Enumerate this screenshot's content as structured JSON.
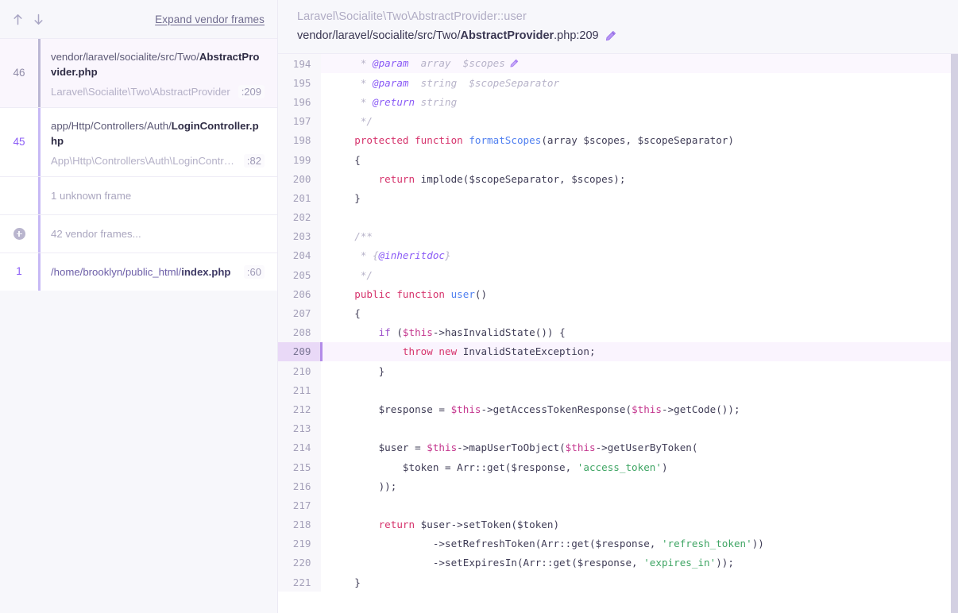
{
  "toolbar": {
    "nav_up_label": "↑",
    "nav_down_label": "↓",
    "expand_vendor_label": "Expand vendor frames"
  },
  "frames": [
    {
      "number": "46",
      "path_prefix": "vendor/laravel/socialite/src/Two/",
      "path_file": "AbstractProvider.php",
      "class_name": "Laravel\\Socialite\\Two\\AbstractProvider",
      "line_badge": ":209",
      "selected": true
    },
    {
      "number": "45",
      "path_prefix": "app/Http/Controllers/Auth/",
      "path_file": "LoginController.php",
      "class_name": "App\\Http\\Controllers\\Auth\\LoginController",
      "line_badge": ":82",
      "selected": false
    }
  ],
  "unknown_frame": {
    "label": "1 unknown frame"
  },
  "vendor_frames": {
    "label": "42 vendor frames...",
    "icon": "plus-circle-icon"
  },
  "entry_frame": {
    "number": "1",
    "path_prefix": "/home/brooklyn/public_html/",
    "path_file": "index.php",
    "line_badge": ":60"
  },
  "code_header": {
    "class_method": "Laravel\\Socialite\\Two\\AbstractProvider::user",
    "file_prefix": "vendor/laravel/socialite/src/Two/",
    "file_name": "AbstractProvider",
    "file_suffix": ".php:209",
    "edit_icon": "pencil-icon"
  },
  "code": {
    "highlighted_line": 209,
    "hover_line": 194,
    "lines": [
      {
        "n": "194",
        "html": "    <span class='t-cmt'>* </span><span class='t-tag'>@param</span><span class='t-cmt'>  array  $scopes</span>",
        "pencil": true
      },
      {
        "n": "195",
        "html": "    <span class='t-cmt'>* </span><span class='t-tag'>@param</span><span class='t-cmt'>  string  $scopeSeparator</span>"
      },
      {
        "n": "196",
        "html": "    <span class='t-cmt'>* </span><span class='t-tag'>@return</span><span class='t-cmt'> string</span>"
      },
      {
        "n": "197",
        "html": "    <span class='t-cmt'>*/</span>"
      },
      {
        "n": "198",
        "html": "   <span class='t-kw'>protected function </span><span class='t-fn'>formatScopes</span><span class='t-punct'>(array $scopes, $scopeSeparator)</span>"
      },
      {
        "n": "199",
        "html": "   <span class='t-punct'>{</span>"
      },
      {
        "n": "200",
        "html": "       <span class='t-kw'>return</span><span class='t-punct'> implode($scopeSeparator, $scopes);</span>"
      },
      {
        "n": "201",
        "html": "   <span class='t-punct'>}</span>"
      },
      {
        "n": "202",
        "html": ""
      },
      {
        "n": "203",
        "html": "   <span class='t-cmt'>/**</span>"
      },
      {
        "n": "204",
        "html": "    <span class='t-cmt'>* {</span><span class='t-tag'>@inheritdoc</span><span class='t-cmt'>}</span>"
      },
      {
        "n": "205",
        "html": "    <span class='t-cmt'>*/</span>"
      },
      {
        "n": "206",
        "html": "   <span class='t-kw'>public function </span><span class='t-fn'>user</span><span class='t-punct'>()</span>"
      },
      {
        "n": "207",
        "html": "   <span class='t-punct'>{</span>"
      },
      {
        "n": "208",
        "html": "       <span class='t-kw2'>if </span><span class='t-punct'>(</span><span class='t-this'>$this</span><span class='t-punct'>-&gt;hasInvalidState()) {</span>"
      },
      {
        "n": "209",
        "html": "           <span class='t-kw'>throw new </span><span class='t-punct'>InvalidStateException;</span>"
      },
      {
        "n": "210",
        "html": "       <span class='t-punct'>}</span>"
      },
      {
        "n": "211",
        "html": ""
      },
      {
        "n": "212",
        "html": "       <span class='t-punct'>$response = </span><span class='t-this'>$this</span><span class='t-punct'>-&gt;getAccessTokenResponse(</span><span class='t-this'>$this</span><span class='t-punct'>-&gt;getCode());</span>"
      },
      {
        "n": "213",
        "html": ""
      },
      {
        "n": "214",
        "html": "       <span class='t-punct'>$user = </span><span class='t-this'>$this</span><span class='t-punct'>-&gt;mapUserToObject(</span><span class='t-this'>$this</span><span class='t-punct'>-&gt;getUserByToken(</span>"
      },
      {
        "n": "215",
        "html": "           <span class='t-punct'>$token = Arr::get($response, </span><span class='t-str'>'access_token'</span><span class='t-punct'>)</span>"
      },
      {
        "n": "216",
        "html": "       <span class='t-punct'>));</span>"
      },
      {
        "n": "217",
        "html": ""
      },
      {
        "n": "218",
        "html": "       <span class='t-kw'>return </span><span class='t-punct'>$user-&gt;setToken($token)</span>"
      },
      {
        "n": "219",
        "html": "                <span class='t-punct'>-&gt;setRefreshToken(Arr::get($response, </span><span class='t-str'>'refresh_token'</span><span class='t-punct'>))</span>"
      },
      {
        "n": "220",
        "html": "                <span class='t-punct'>-&gt;setExpiresIn(Arr::get($response, </span><span class='t-str'>'expires_in'</span><span class='t-punct'>));</span>"
      },
      {
        "n": "221",
        "html": "   <span class='t-punct'>}</span>"
      }
    ]
  },
  "colors": {
    "accent": "#8b5cf6",
    "sidebar_bg": "#f7f7fb",
    "highlight_row": "#faf4fe",
    "gutter_highlight": "#e9d9f7",
    "string_green": "#3fa564",
    "keyword_pink": "#d6336c",
    "this_magenta": "#c4368e",
    "function_blue": "#4f7ff0"
  }
}
